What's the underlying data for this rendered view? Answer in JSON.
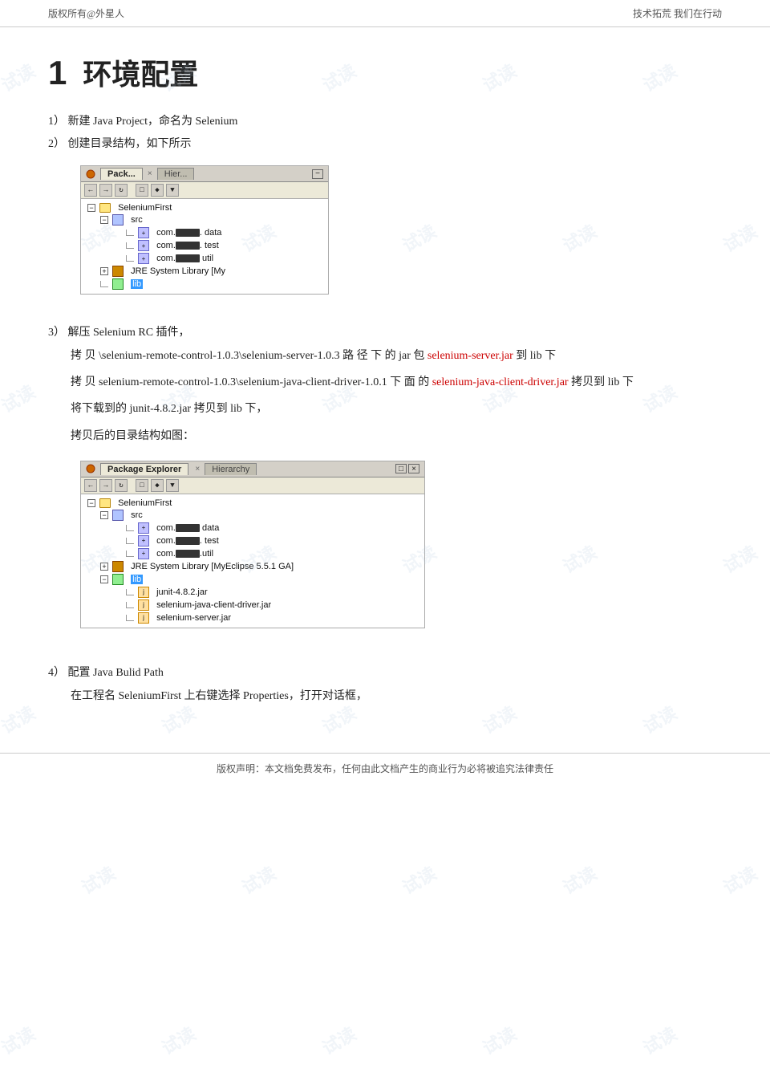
{
  "header": {
    "left": "版权所有@外星人",
    "right": "技术拓荒 我们在行动"
  },
  "chapter": {
    "number": "1",
    "title": "环境配置"
  },
  "steps": {
    "step1": "1） 新建 Java Project，命名为 Selenium",
    "step2": "2） 创建目录结构，如下所示",
    "step3": "3） 解压 Selenium RC 插件，",
    "step3_p1_pre": "拷 贝 \\selenium-remote-control-1.0.3\\selenium-server-1.0.3   路 径 下 的  jar  包",
    "step3_link1": "selenium-server.jar",
    "step3_p1_post": " 到 lib 下",
    "step3_p2_pre": "拷 贝   selenium-remote-control-1.0.3\\selenium-java-client-driver-1.0.1   下 面 的",
    "step3_link2": "selenium-java-client-driver.jar",
    "step3_p2_post": " 拷贝到 lib 下",
    "step3_p3": "将下载到的 junit-4.8.2.jar 拷贝到 lib 下，",
    "step3_p4": "拷贝后的目录结构如图：",
    "step4": "4） 配置 Java Bulid Path",
    "step4_p1": "在工程名 SeleniumFirst 上右键选择 Properties，打开对话框，"
  },
  "ide1": {
    "tab1_label": "Pack...",
    "tab1_close": "×",
    "tab2_label": "Hier...",
    "win_minimize": "−",
    "tree": {
      "root": "SeleniumFirst",
      "src": "src",
      "pkg_data_prefix": "com.",
      "pkg_data_suffix": ". data",
      "pkg_test_prefix": "com.",
      "pkg_test_suffix": ". test",
      "pkg_util_prefix": "com.",
      "pkg_util_suffix": " util",
      "jre": "JRE System Library [My",
      "lib": "lib"
    }
  },
  "ide2": {
    "tab1_label": "Package Explorer",
    "tab1_close": "×",
    "tab2_label": "Hierarchy",
    "win_restore": "□",
    "win_close": "×",
    "tree": {
      "root": "SeleniumFirst",
      "src": "src",
      "pkg_data_prefix": "com.",
      "pkg_data_suffix": " data",
      "pkg_test_prefix": "com.",
      "pkg_test_suffix": ". test",
      "pkg_util_prefix": "com.",
      "pkg_util_suffix": ".util",
      "jre": "JRE System Library [MyEclipse 5.5.1 GA]",
      "lib": "lib",
      "jar1": "junit-4.8.2.jar",
      "jar2": "selenium-java-client-driver.jar",
      "jar3": "selenium-server.jar"
    }
  },
  "footer": {
    "text": "版权声明：本文档免费发布，任何由此文档产生的商业行为必将被追究法律责任"
  },
  "watermarks": [
    "试读",
    "试读",
    "试读",
    "试读",
    "试读",
    "试读"
  ]
}
